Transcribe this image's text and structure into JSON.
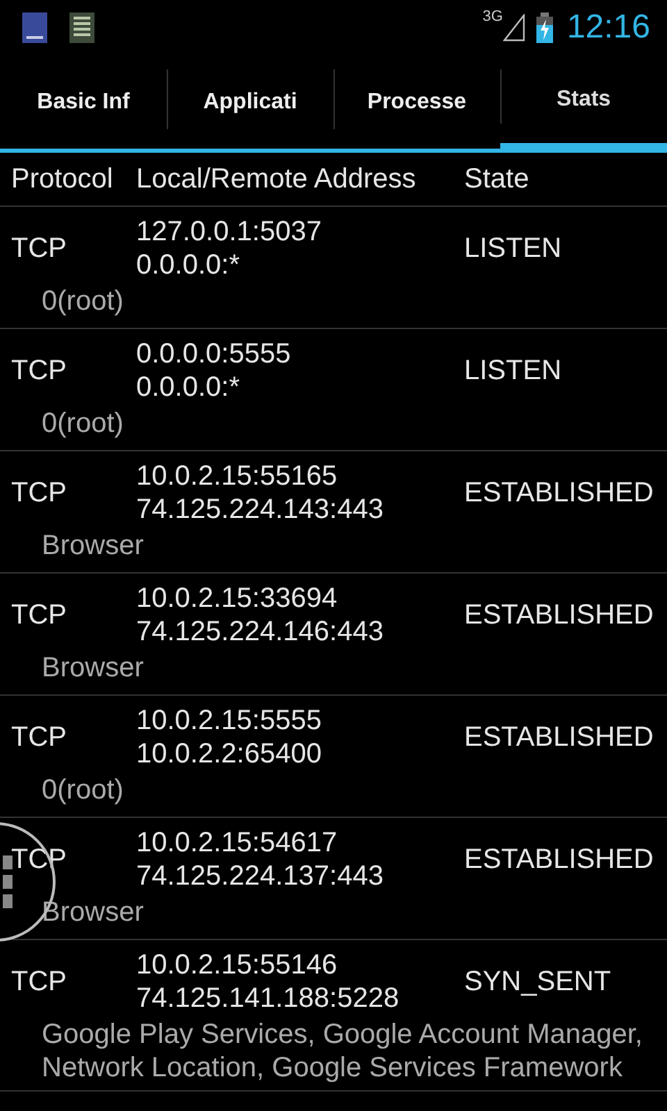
{
  "status_bar": {
    "network": "3G",
    "time": "12:16"
  },
  "tabs": [
    {
      "label": "Basic Inf",
      "selected": false
    },
    {
      "label": "Applicati",
      "selected": false
    },
    {
      "label": "Processe",
      "selected": false
    },
    {
      "label": "Stats",
      "selected": true
    }
  ],
  "table": {
    "columns": [
      "Protocol",
      "Local/Remote Address",
      "State"
    ],
    "rows": [
      {
        "protocol": "TCP",
        "local": "127.0.0.1:5037",
        "remote": "0.0.0.0:*",
        "state": "LISTEN",
        "owner": [
          "0(root)"
        ]
      },
      {
        "protocol": "TCP",
        "local": "0.0.0.0:5555",
        "remote": "0.0.0.0:*",
        "state": "LISTEN",
        "owner": [
          "0(root)"
        ]
      },
      {
        "protocol": "TCP",
        "local": "10.0.2.15:55165",
        "remote": "74.125.224.143:443",
        "state": "ESTABLISHED",
        "owner": [
          "Browser"
        ]
      },
      {
        "protocol": "TCP",
        "local": "10.0.2.15:33694",
        "remote": "74.125.224.146:443",
        "state": "ESTABLISHED",
        "owner": [
          "Browser"
        ]
      },
      {
        "protocol": "TCP",
        "local": "10.0.2.15:5555",
        "remote": "10.0.2.2:65400",
        "state": "ESTABLISHED",
        "owner": [
          "0(root)"
        ]
      },
      {
        "protocol": "TCP",
        "local": "10.0.2.15:54617",
        "remote": "74.125.224.137:443",
        "state": "ESTABLISHED",
        "owner": [
          "Browser"
        ]
      },
      {
        "protocol": "TCP",
        "local": "10.0.2.15:55146",
        "remote": "74.125.141.188:5228",
        "state": "SYN_SENT",
        "owner": [
          "Google Play Services, Google Account Manager,",
          "Network Location, Google Services Framework"
        ]
      }
    ]
  }
}
